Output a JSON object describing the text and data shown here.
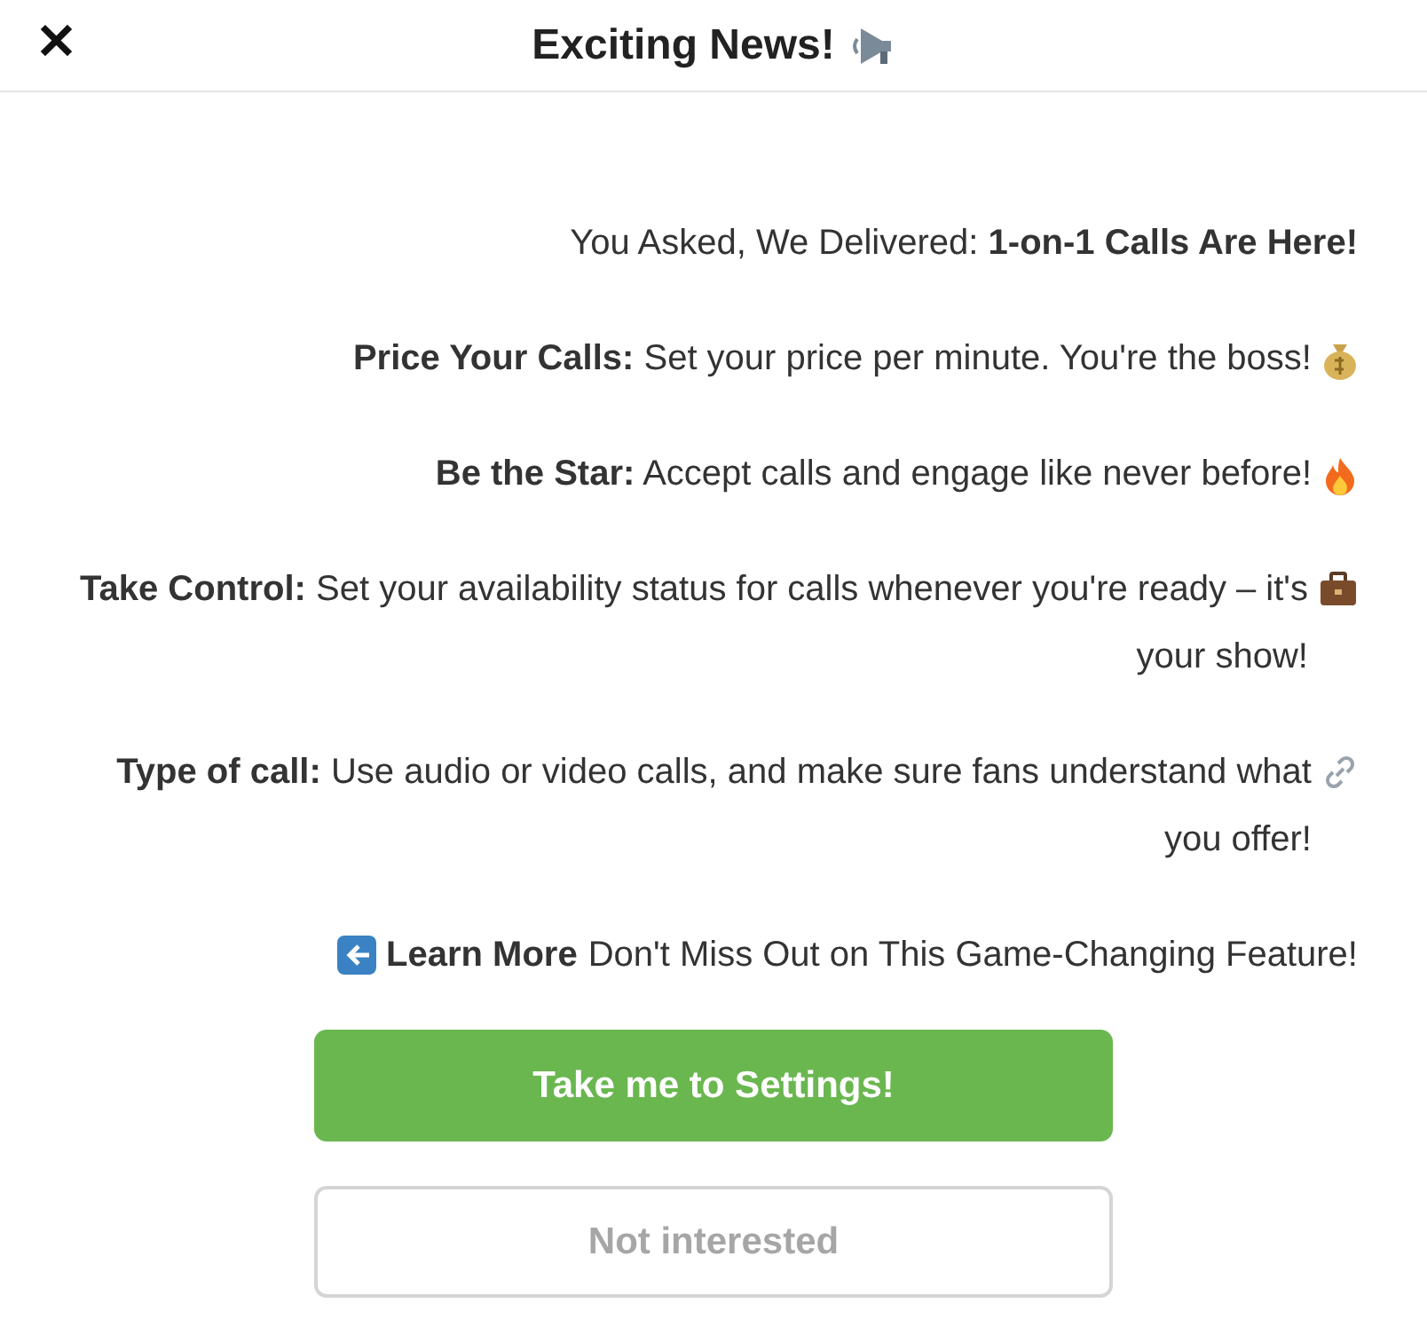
{
  "dialog": {
    "title": "Exciting News!",
    "close": "✕"
  },
  "intro": "You Asked, We Delivered: **1-on-1 Calls Are Here!**",
  "features": [
    {
      "kind": "money",
      "text": "**Price Your Calls:** Set your price per minute. You're the boss!"
    },
    {
      "kind": "fire",
      "text": "**Be the Star:** Accept calls and engage like never before!"
    },
    {
      "kind": "briefcase",
      "text": "**Take Control:** Set your availability status for calls whenever you're ready – it's your show!"
    },
    {
      "kind": "link",
      "text": "**Type of call:** Use audio or video calls, and make sure fans understand what you offer!"
    }
  ],
  "footer": {
    "text": "Don't Miss Out on This Game-Changing Feature!",
    "link": "Learn More"
  },
  "buttons": [
    {
      "kind": "primary",
      "label": "Take me to Settings!"
    },
    {
      "kind": "secondary",
      "label": "Not interested"
    }
  ]
}
